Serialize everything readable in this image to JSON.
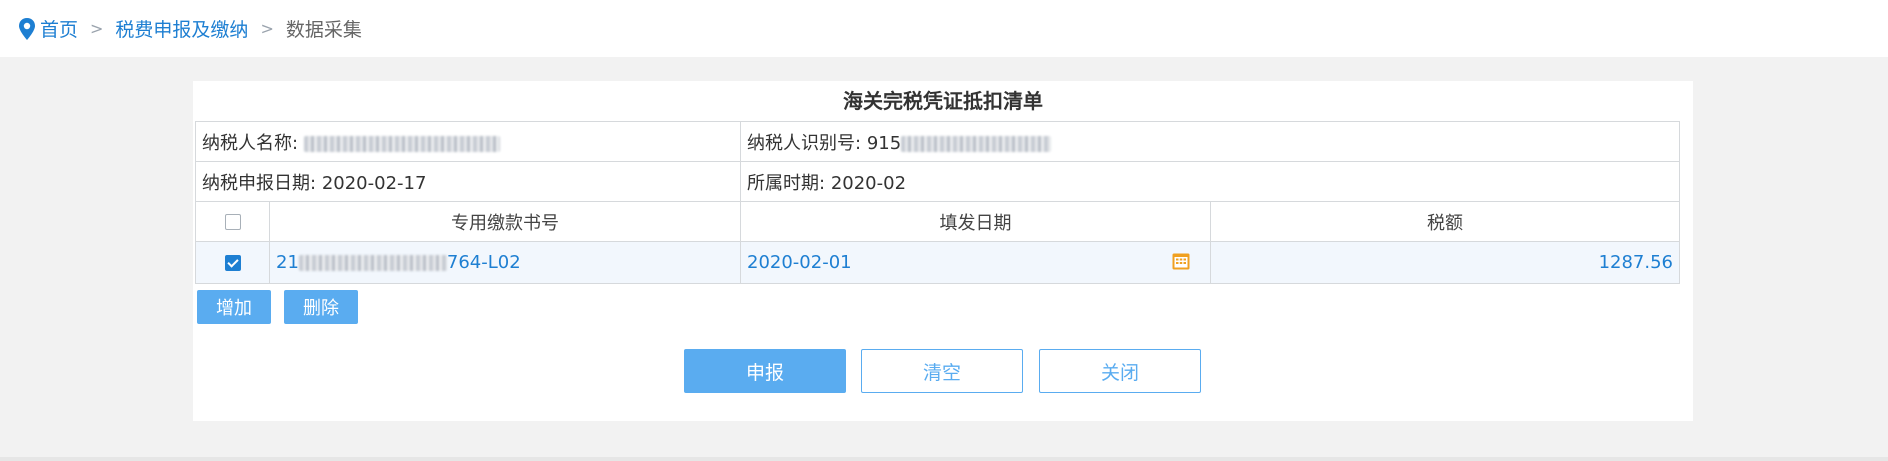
{
  "breadcrumb": {
    "home": "首页",
    "section": "税费申报及缴纳",
    "current": "数据采集",
    "separator": ">"
  },
  "form": {
    "title": "海关完税凭证抵扣清单",
    "taxpayer_name_label": "纳税人名称:",
    "taxpayer_id_label": "纳税人识别号:",
    "taxpayer_id_prefix": "915",
    "declare_date_label": "纳税申报日期:",
    "declare_date": "2020-02-17",
    "period_label": "所属时期:",
    "period": "2020-02"
  },
  "table": {
    "headers": [
      "专用缴款书号",
      "填发日期",
      "税额"
    ],
    "rows": [
      {
        "checked": true,
        "doc_no_prefix": "21",
        "doc_no_suffix": "764-L02",
        "issue_date": "2020-02-01",
        "tax_amount": "1287.56"
      }
    ]
  },
  "actions": {
    "add": "增加",
    "delete": "删除",
    "submit": "申报",
    "clear": "清空",
    "close": "关闭"
  },
  "colors": {
    "link": "#1e7fd2",
    "button": "#5aacf0",
    "calendar": "#f0a020"
  }
}
